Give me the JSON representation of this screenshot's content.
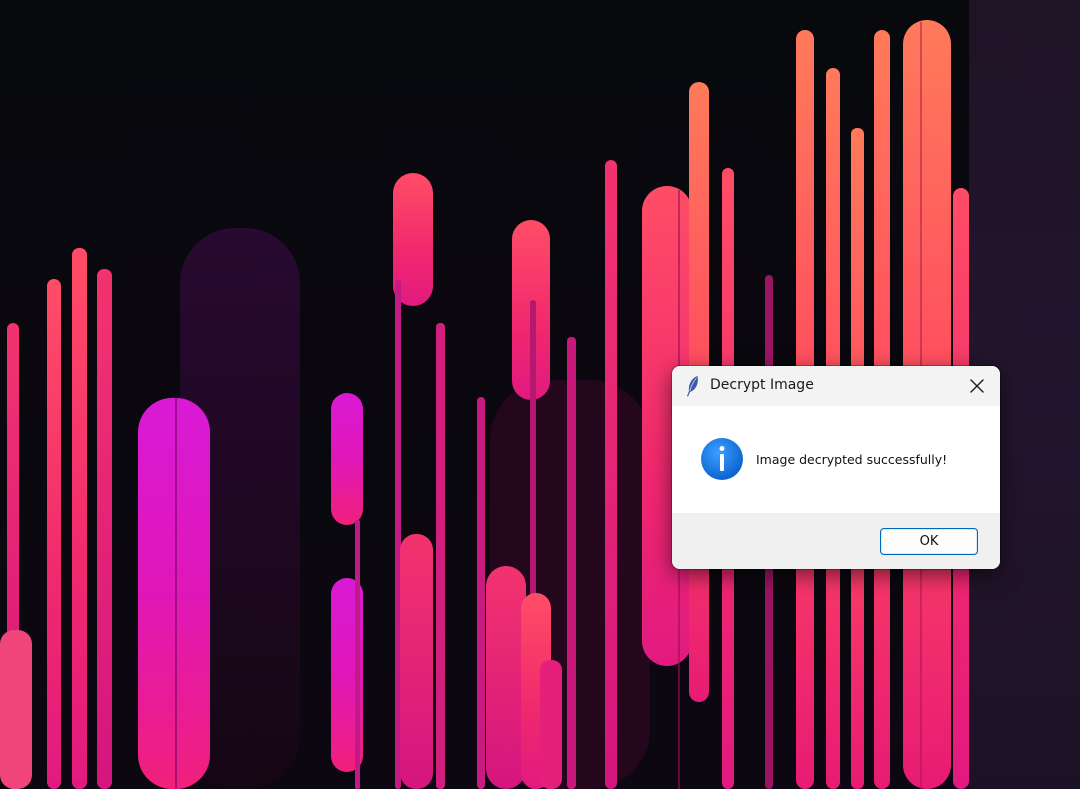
{
  "dialog": {
    "title": "Decrypt Image",
    "title_icon": "feather-icon",
    "close_icon": "close-icon",
    "message_icon": "info-icon",
    "message": "Image decrypted successfully!",
    "ok_label": "OK"
  },
  "wallpaper": {
    "description_colors": [
      "#ff3f6c",
      "#e0187e",
      "#c81cc8",
      "#07080c"
    ]
  }
}
